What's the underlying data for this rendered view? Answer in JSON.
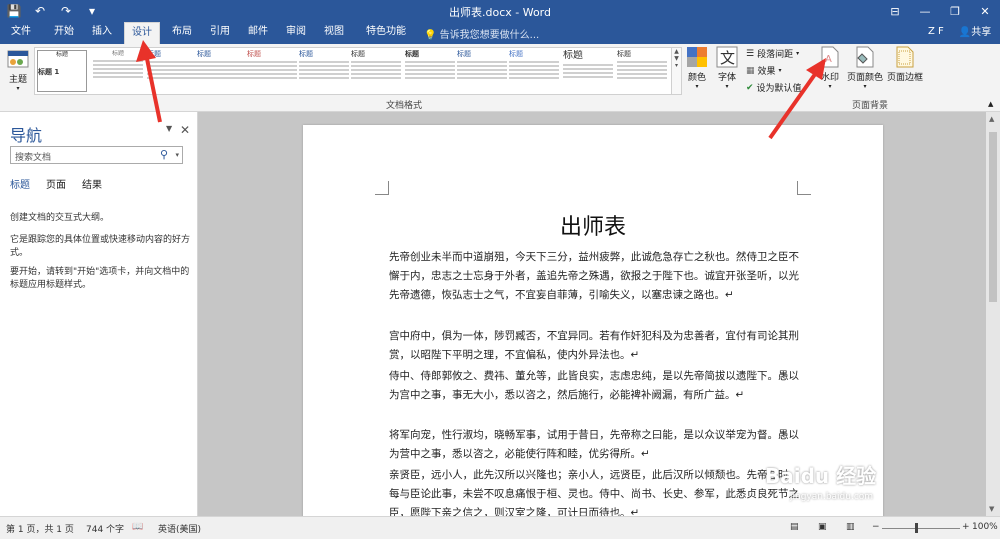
{
  "app": {
    "title": "出师表.docx - Word"
  },
  "window_controls": {
    "ribbon_opts": "⊟",
    "minimize": "—",
    "restore": "❐",
    "close": "✕"
  },
  "qat": {
    "save": "💾",
    "undo": "↶",
    "redo": "↷",
    "customize": "▾"
  },
  "tabs": [
    {
      "label": "文件",
      "active": false
    },
    {
      "label": "开始",
      "active": false
    },
    {
      "label": "插入",
      "active": false
    },
    {
      "label": "设计",
      "active": true
    },
    {
      "label": "布局",
      "active": false
    },
    {
      "label": "引用",
      "active": false
    },
    {
      "label": "邮件",
      "active": false
    },
    {
      "label": "审阅",
      "active": false
    },
    {
      "label": "视图",
      "active": false
    },
    {
      "label": "特色功能",
      "active": false
    }
  ],
  "tell_me": "告诉我您想要做什么...",
  "user": "Z F",
  "share": "共享",
  "ribbon": {
    "theme_label": "主题",
    "gallery_first_caption": "标题 1",
    "gallery_first_title": "标题",
    "gallery_thumb_title": "标题",
    "group_document_format": "文档格式",
    "colors_label": "颜色",
    "fonts_label": "字体",
    "paragraph_spacing": "段落间距",
    "effects": "效果",
    "set_default": "设为默认值",
    "watermark": "水印",
    "page_color": "页面颜色",
    "page_borders": "页面边框",
    "group_page_background": "页面背景",
    "colors": {
      "accent": "#2b579a",
      "arrow": "#e8322a"
    }
  },
  "nav": {
    "title": "导航",
    "search_placeholder": "搜索文档",
    "tabs": [
      "标题",
      "页面",
      "结果"
    ],
    "text1": "创建文档的交互式大纲。",
    "text2": "它是跟踪您的具体位置或快速移动内容的好方式。",
    "text3": "要开始，请转到\"开始\"选项卡，并向文档中的标题应用标题样式。"
  },
  "document": {
    "title": "出师表",
    "paragraphs": [
      "先帝创业未半而中道崩殂，今天下三分，益州疲弊，此诚危急存亡之秋也。然侍卫之臣不懈于内，忠志之士忘身于外者，盖追先帝之殊遇，欲报之于陛下也。诚宜开张圣听，以光先帝遗德，恢弘志士之气，不宜妄自菲薄，引喻失义，以塞忠谏之路也。↵",
      "宫中府中，俱为一体，陟罚臧否，不宜异同。若有作奸犯科及为忠善者，宜付有司论其刑赏，以昭陛下平明之理，不宜偏私，使内外异法也。↵",
      "侍中、侍郎郭攸之、费祎、董允等，此皆良实，志虑忠纯，是以先帝简拔以遗陛下。愚以为宫中之事，事无大小，悉以咨之，然后施行，必能裨补阙漏，有所广益。↵",
      "将军向宠，性行淑均，晓畅军事，试用于昔日，先帝称之曰能，是以众议举宠为督。愚以为营中之事，悉以咨之，必能使行阵和睦，优劣得所。↵",
      "亲贤臣，远小人，此先汉所以兴隆也；亲小人，远贤臣，此后汉所以倾颓也。先帝在时，每与臣论此事，未尝不叹息痛恨于桓、灵也。侍中、尚书、长史、参军，此悉贞良死节之臣，愿陛下亲之信之，则汉室之隆，可计日而待也。↵"
    ]
  },
  "status": {
    "page": "第 1 页，共 1 页",
    "words": "744 个字",
    "language": "英语(美国)",
    "zoom": "100%"
  },
  "watermark_text": "Baidu 经验",
  "watermark_url": "jingyan.baidu.com"
}
